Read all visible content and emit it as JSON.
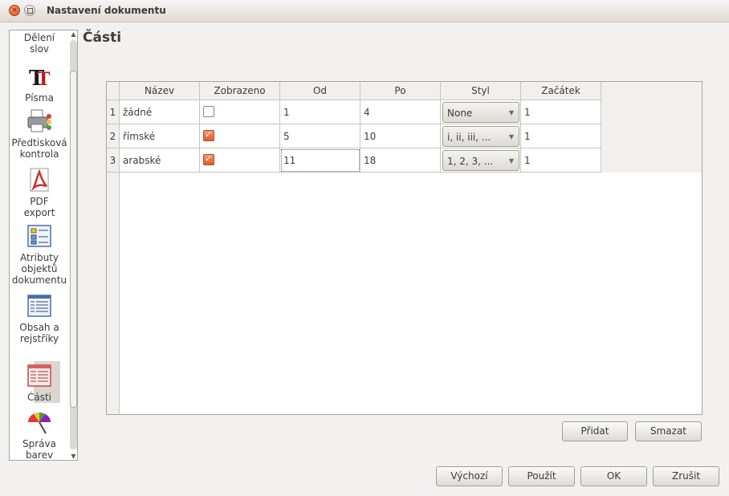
{
  "window": {
    "title": "Nastavení dokumentu"
  },
  "sidebar": {
    "items": [
      {
        "label": "Dělení\nslov",
        "icon": "hyphenation-icon"
      },
      {
        "label": "Písma",
        "icon": "fonts-icon"
      },
      {
        "label": "Předtisková\nkontrola",
        "icon": "printer-preflight-icon"
      },
      {
        "label": "PDF\nexport",
        "icon": "pdf-icon"
      },
      {
        "label": "Atributy\nobjektů\ndokumentu",
        "icon": "object-attributes-icon"
      },
      {
        "label": "Obsah a\nrejstříky",
        "icon": "toc-icon"
      },
      {
        "label": "Části",
        "icon": "sections-icon",
        "active": true
      },
      {
        "label": "Správa\nbarev",
        "icon": "color-management-icon"
      }
    ]
  },
  "main": {
    "title": "Části",
    "table": {
      "columns": [
        "Název",
        "Zobrazeno",
        "Od",
        "Po",
        "Styl",
        "Začátek"
      ],
      "rows": [
        {
          "num": "1",
          "name": "žádné",
          "shown": false,
          "from": "1",
          "to": "4",
          "style": "None",
          "start": "1"
        },
        {
          "num": "2",
          "name": "římské",
          "shown": true,
          "from": "5",
          "to": "10",
          "style": "i, ii, iii, ...",
          "start": "1"
        },
        {
          "num": "3",
          "name": "arabské",
          "shown": true,
          "from": "11",
          "to": "18",
          "style": "1, 2, 3, ...",
          "start": "1"
        }
      ]
    }
  },
  "buttons": {
    "add": "Přidat",
    "delete": "Smazat",
    "default": "Výchozí",
    "apply": "Použít",
    "ok": "OK",
    "cancel": "Zrušit"
  },
  "colors": {
    "accent": "#e05a2b",
    "window_bg": "#f2f1f0"
  }
}
